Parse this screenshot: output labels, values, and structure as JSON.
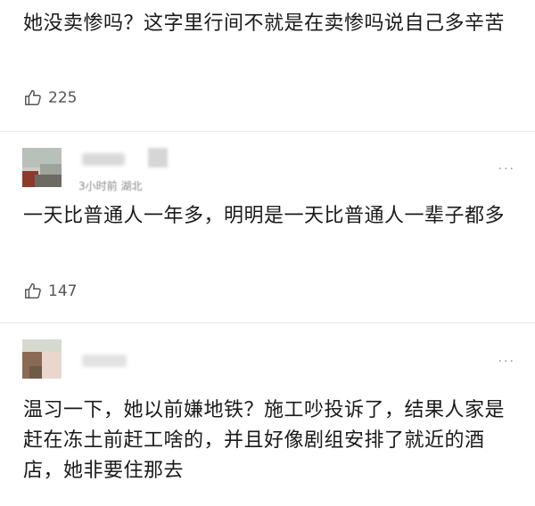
{
  "comments": [
    {
      "text": "她没卖惨吗？这字里行间不就是在卖惨吗说自己多辛苦",
      "likes": "225"
    },
    {
      "meta": "3小时前 湖北",
      "text": "一天比普通人一年多，明明是一天比普通人一辈子都多",
      "likes": "147"
    },
    {
      "text": "温习一下，她以前嫌地铁？施工吵投诉了，结果人家是赶在冻土前赶工啥的，并且好像剧组安排了就近的酒店，她非要住那去"
    }
  ],
  "icons": {
    "like": "thumbs-up-icon",
    "more": "more-dots-icon"
  },
  "more_glyph": "···"
}
